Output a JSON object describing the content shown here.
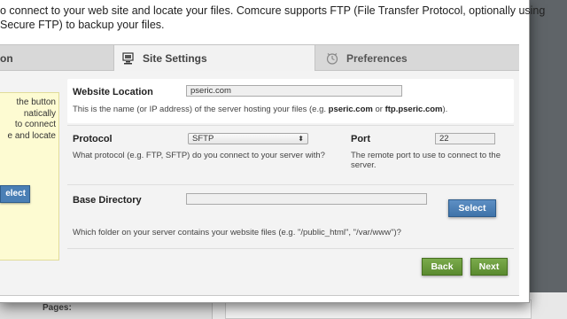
{
  "intro": {
    "line1": "o connect to your web site and locate your files. Comcure supports FTP (File Transfer Protocol, optionally using",
    "line2": "Secure FTP) to backup your files."
  },
  "tabs": [
    {
      "label": "on",
      "icon": ""
    },
    {
      "label": "Site Settings",
      "icon": "server-icon"
    },
    {
      "label": "Preferences",
      "icon": "clock-icon"
    }
  ],
  "side_note": {
    "lines": [
      "the button",
      "natically",
      "to connect",
      "e and locate"
    ],
    "button_label": "elect"
  },
  "website_location": {
    "label": "Website Location",
    "value": "pseric.com",
    "help_prefix": "This is the name (or IP address) of the server hosting your files (e.g. ",
    "help_example1": "pseric.com",
    "help_mid": " or ",
    "help_example2": "ftp.pseric.com",
    "help_suffix": ")."
  },
  "protocol": {
    "label": "Protocol",
    "value": "SFTP",
    "help": "What protocol (e.g. FTP, SFTP) do you connect to your server with?"
  },
  "port": {
    "label": "Port",
    "value": "22",
    "help_line1": "The remote port to use to connect to the",
    "help_line2": "server."
  },
  "base_directory": {
    "label": "Base Directory",
    "value": "",
    "select_label": "Select",
    "help": "Which folder on your server contains your website files (e.g. \"/public_html\", \"/var/www\")?"
  },
  "footer": {
    "back_label": "Back",
    "next_label": "Next"
  },
  "background": {
    "pages_label": "Pages:"
  },
  "colors": {
    "accent_blue": "#4a7fb5",
    "accent_green": "#5f9035",
    "note_bg": "#fdfbd2"
  }
}
